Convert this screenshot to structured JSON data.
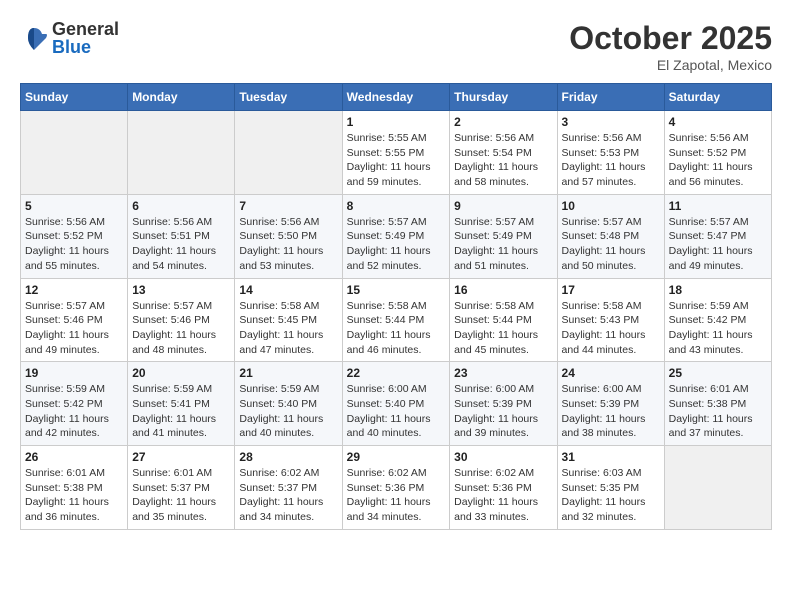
{
  "header": {
    "logo": {
      "general": "General",
      "blue": "Blue"
    },
    "title": "October 2025",
    "location": "El Zapotal, Mexico"
  },
  "weekdays": [
    "Sunday",
    "Monday",
    "Tuesday",
    "Wednesday",
    "Thursday",
    "Friday",
    "Saturday"
  ],
  "weeks": [
    [
      {
        "day": null,
        "info": null
      },
      {
        "day": null,
        "info": null
      },
      {
        "day": null,
        "info": null
      },
      {
        "day": "1",
        "info": "Sunrise: 5:55 AM\nSunset: 5:55 PM\nDaylight: 11 hours\nand 59 minutes."
      },
      {
        "day": "2",
        "info": "Sunrise: 5:56 AM\nSunset: 5:54 PM\nDaylight: 11 hours\nand 58 minutes."
      },
      {
        "day": "3",
        "info": "Sunrise: 5:56 AM\nSunset: 5:53 PM\nDaylight: 11 hours\nand 57 minutes."
      },
      {
        "day": "4",
        "info": "Sunrise: 5:56 AM\nSunset: 5:52 PM\nDaylight: 11 hours\nand 56 minutes."
      }
    ],
    [
      {
        "day": "5",
        "info": "Sunrise: 5:56 AM\nSunset: 5:52 PM\nDaylight: 11 hours\nand 55 minutes."
      },
      {
        "day": "6",
        "info": "Sunrise: 5:56 AM\nSunset: 5:51 PM\nDaylight: 11 hours\nand 54 minutes."
      },
      {
        "day": "7",
        "info": "Sunrise: 5:56 AM\nSunset: 5:50 PM\nDaylight: 11 hours\nand 53 minutes."
      },
      {
        "day": "8",
        "info": "Sunrise: 5:57 AM\nSunset: 5:49 PM\nDaylight: 11 hours\nand 52 minutes."
      },
      {
        "day": "9",
        "info": "Sunrise: 5:57 AM\nSunset: 5:49 PM\nDaylight: 11 hours\nand 51 minutes."
      },
      {
        "day": "10",
        "info": "Sunrise: 5:57 AM\nSunset: 5:48 PM\nDaylight: 11 hours\nand 50 minutes."
      },
      {
        "day": "11",
        "info": "Sunrise: 5:57 AM\nSunset: 5:47 PM\nDaylight: 11 hours\nand 49 minutes."
      }
    ],
    [
      {
        "day": "12",
        "info": "Sunrise: 5:57 AM\nSunset: 5:46 PM\nDaylight: 11 hours\nand 49 minutes."
      },
      {
        "day": "13",
        "info": "Sunrise: 5:57 AM\nSunset: 5:46 PM\nDaylight: 11 hours\nand 48 minutes."
      },
      {
        "day": "14",
        "info": "Sunrise: 5:58 AM\nSunset: 5:45 PM\nDaylight: 11 hours\nand 47 minutes."
      },
      {
        "day": "15",
        "info": "Sunrise: 5:58 AM\nSunset: 5:44 PM\nDaylight: 11 hours\nand 46 minutes."
      },
      {
        "day": "16",
        "info": "Sunrise: 5:58 AM\nSunset: 5:44 PM\nDaylight: 11 hours\nand 45 minutes."
      },
      {
        "day": "17",
        "info": "Sunrise: 5:58 AM\nSunset: 5:43 PM\nDaylight: 11 hours\nand 44 minutes."
      },
      {
        "day": "18",
        "info": "Sunrise: 5:59 AM\nSunset: 5:42 PM\nDaylight: 11 hours\nand 43 minutes."
      }
    ],
    [
      {
        "day": "19",
        "info": "Sunrise: 5:59 AM\nSunset: 5:42 PM\nDaylight: 11 hours\nand 42 minutes."
      },
      {
        "day": "20",
        "info": "Sunrise: 5:59 AM\nSunset: 5:41 PM\nDaylight: 11 hours\nand 41 minutes."
      },
      {
        "day": "21",
        "info": "Sunrise: 5:59 AM\nSunset: 5:40 PM\nDaylight: 11 hours\nand 40 minutes."
      },
      {
        "day": "22",
        "info": "Sunrise: 6:00 AM\nSunset: 5:40 PM\nDaylight: 11 hours\nand 40 minutes."
      },
      {
        "day": "23",
        "info": "Sunrise: 6:00 AM\nSunset: 5:39 PM\nDaylight: 11 hours\nand 39 minutes."
      },
      {
        "day": "24",
        "info": "Sunrise: 6:00 AM\nSunset: 5:39 PM\nDaylight: 11 hours\nand 38 minutes."
      },
      {
        "day": "25",
        "info": "Sunrise: 6:01 AM\nSunset: 5:38 PM\nDaylight: 11 hours\nand 37 minutes."
      }
    ],
    [
      {
        "day": "26",
        "info": "Sunrise: 6:01 AM\nSunset: 5:38 PM\nDaylight: 11 hours\nand 36 minutes."
      },
      {
        "day": "27",
        "info": "Sunrise: 6:01 AM\nSunset: 5:37 PM\nDaylight: 11 hours\nand 35 minutes."
      },
      {
        "day": "28",
        "info": "Sunrise: 6:02 AM\nSunset: 5:37 PM\nDaylight: 11 hours\nand 34 minutes."
      },
      {
        "day": "29",
        "info": "Sunrise: 6:02 AM\nSunset: 5:36 PM\nDaylight: 11 hours\nand 34 minutes."
      },
      {
        "day": "30",
        "info": "Sunrise: 6:02 AM\nSunset: 5:36 PM\nDaylight: 11 hours\nand 33 minutes."
      },
      {
        "day": "31",
        "info": "Sunrise: 6:03 AM\nSunset: 5:35 PM\nDaylight: 11 hours\nand 32 minutes."
      },
      {
        "day": null,
        "info": null
      }
    ]
  ]
}
